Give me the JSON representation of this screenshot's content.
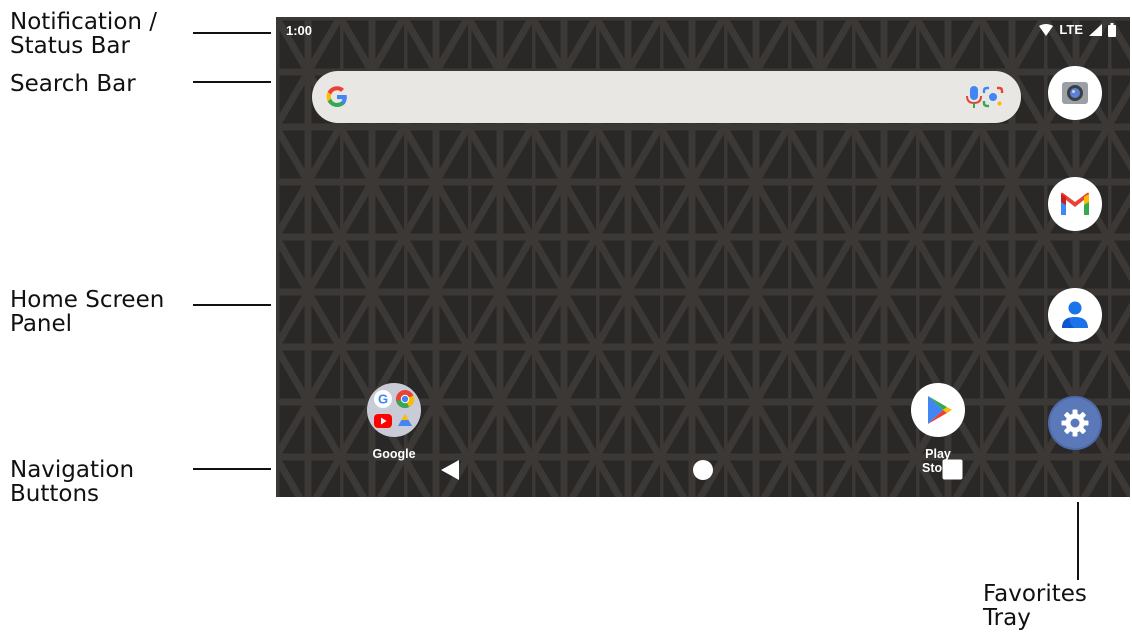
{
  "callouts": {
    "status_bar_line1": "Notification /",
    "status_bar_line2": "Status Bar",
    "search_bar": "Search Bar",
    "home_panel_line1": "Home Screen",
    "home_panel_line2": "Panel",
    "nav_line1": "Navigation",
    "nav_line2": "Buttons",
    "favorites_line1": "Favorites",
    "favorites_line2": "Tray"
  },
  "status_bar": {
    "time": "1:00",
    "network": "LTE",
    "icons": [
      "wifi-icon",
      "signal-icon",
      "battery-icon"
    ]
  },
  "search_bar": {
    "icons": [
      "google-g-icon",
      "microphone-icon",
      "lens-icon"
    ]
  },
  "apps": {
    "google_folder": {
      "label": "Google",
      "icons": [
        "google-icon",
        "chrome-icon",
        "youtube-icon",
        "drive-icon"
      ]
    },
    "play_store": {
      "label": "Play Store"
    }
  },
  "favorites_tray": [
    "camera-icon",
    "gmail-icon",
    "contacts-icon",
    "settings-icon"
  ],
  "navigation": [
    "back-icon",
    "home-icon",
    "recents-icon"
  ],
  "colors": {
    "wallpaper": "#2a2827",
    "search_bar": "#e9e7e4",
    "google_blue": "#4285F4",
    "google_red": "#EA4335",
    "google_yellow": "#FBBC04",
    "google_green": "#34A853"
  }
}
